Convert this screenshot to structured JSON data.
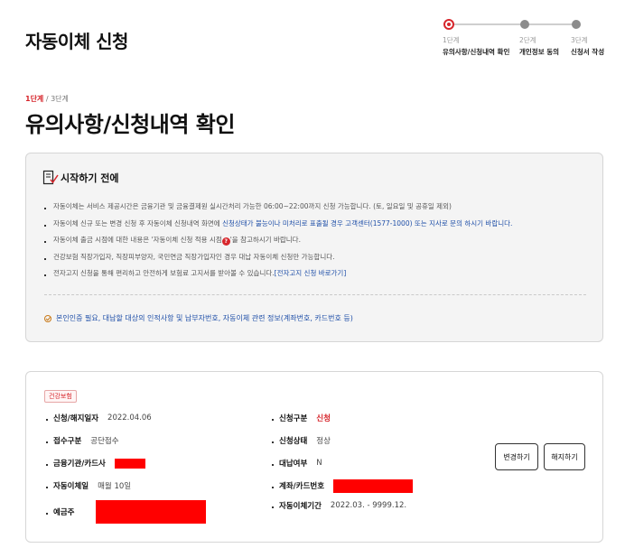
{
  "page": {
    "title": "자동이체 신청"
  },
  "stepper": {
    "steps": [
      {
        "num": "1단계",
        "label": "유의사항/신청내역 확인"
      },
      {
        "num": "2단계",
        "label": "개인정보 동의"
      },
      {
        "num": "3단계",
        "label": "신청서 작성"
      }
    ]
  },
  "progress": {
    "current": "1단계",
    "total": " / 3단계"
  },
  "section": {
    "title": "유의사항/신청내역 확인"
  },
  "notice": {
    "title": "시작하기 전에",
    "items": {
      "i0": "자동이체는 서비스 제공시간은 금융기관 및 금융결제원 실시간처리 가능한 06:00~22:00까지 신청 가능합니다. (토, 일요일 및 공휴일 제외)",
      "i1_pre": "자동이체 신규 또는 변경 신청 후 자동이체 신청내역 화면에 ",
      "i1_blue": "신청상태가 불능이나 미처리로 표출될 경우 고객센터(1577-1000) 또는 지사로 문의 하시기 바랍니다.",
      "i2_pre": "자동이체 출금 시점에 대한 내용은 '자동이체 신청 적용 시점",
      "i2_icon": "?",
      "i2_post": "'을 참고하시기 바랍니다.",
      "i3": "건강보험 직장가입자, 직장피부양자, 국민연금 직장가입자인 경우 대납 자동이체 신청만 가능합니다.",
      "i4_pre": "전자고지 신청을 통해 편리하고 안전하게 보험료 고지서를 받아볼 수 있습니다.",
      "i4_link": "[전자고지 신청 바로가기]"
    },
    "footer": "본인인증 필요, 대납할 대상의 인적사항 및 납부자번호, 자동이체 관련 정보(계좌번호, 카드번호 등)"
  },
  "detail": {
    "badge": "건강보험",
    "apply_date": {
      "label": "신청/해지일자",
      "value": "2022.04.06"
    },
    "receipt": {
      "label": "접수구분",
      "value": "공단접수"
    },
    "bank": {
      "label": "금융기관/카드사",
      "value": ""
    },
    "transfer_day": {
      "label": "자동이체일",
      "value": "매월 10일"
    },
    "depositor": {
      "label": "예금주",
      "value": ""
    },
    "apply_type": {
      "label": "신청구분",
      "value": "신청"
    },
    "status": {
      "label": "신청상태",
      "value": "정상"
    },
    "proxy": {
      "label": "대납여부",
      "value": "N"
    },
    "account": {
      "label": "계좌/카드번호",
      "value": ""
    },
    "period": {
      "label": "자동이체기간",
      "value": "2022.03. - 9999.12."
    },
    "buttons": {
      "change": "변경하기",
      "cancel": "해지하기"
    }
  },
  "colors": {
    "accent": "#d7262c",
    "link": "#1f4fa8",
    "redaction": "#ff0000"
  }
}
